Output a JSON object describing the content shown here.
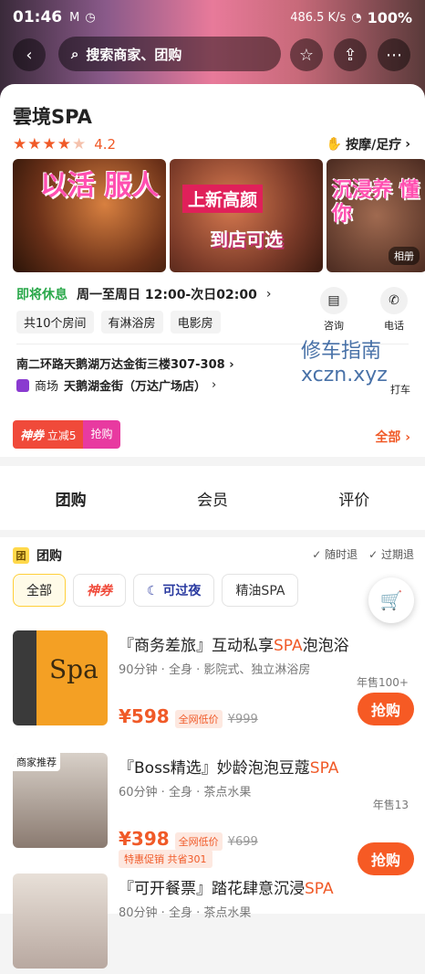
{
  "status": {
    "time": "01:46",
    "speed": "486.5 K/s",
    "battery": "100%"
  },
  "topbar": {
    "search_placeholder": "搜索商家、团购"
  },
  "shop": {
    "name": "雲境SPA",
    "rating": "4.2",
    "category": "按摩/足疗",
    "photos": [
      {
        "text": "以活 服人"
      },
      {
        "ribbon": "上新高颜",
        "text": "到店可选"
      },
      {
        "text": "沉浸养 懂你"
      }
    ],
    "album_label": "相册",
    "status": "即将休息",
    "hours": "周一至周日 12:00-次日02:00",
    "tags": [
      "共10个房间",
      "有淋浴房",
      "电影房"
    ],
    "actions": [
      {
        "label": "咨询"
      },
      {
        "label": "电话"
      }
    ],
    "address": "南二环路天鹅湖万达金街三楼307-308",
    "mall_prefix": "商场",
    "mall": "天鹅湖金街（万达广场店）",
    "taxi": "打车",
    "watermark_line1": "修车指南",
    "watermark_line2": "xczn.xyz",
    "coupon_tag": "神券",
    "coupon_text": "立减5",
    "coupon_btn": "抢购",
    "all": "全部"
  },
  "tabs": [
    "团购",
    "会员",
    "评价"
  ],
  "group": {
    "icon": "团",
    "title": "团购",
    "refund1": "随时退",
    "refund2": "过期退",
    "filters": [
      "全部",
      "神券",
      "可过夜",
      "精油SPA"
    ]
  },
  "items": [
    {
      "title_pre": "『商务差旅』互动私享",
      "title_hl": "SPA",
      "title_post": "泡泡浴",
      "desc": "90分钟 · 全身 · 影院式、独立淋浴房",
      "sold": "年售100+",
      "price": "¥598",
      "low": "全网低价",
      "orig": "¥999",
      "buy": "抢购"
    },
    {
      "badge": "商家推荐",
      "title_pre": "『Boss精选』妙龄泡泡豆蔻",
      "title_hl": "SPA",
      "title_post": "",
      "desc": "60分钟 · 全身 · 茶点水果",
      "sold": "年售13",
      "price": "¥398",
      "low": "全网低价",
      "orig": "¥699",
      "promo": "特惠促销 共省301",
      "buy": "抢购"
    },
    {
      "title_pre": "『可开餐票』踏花肆意沉浸",
      "title_hl": "SPA",
      "title_post": "",
      "desc": "80分钟 · 全身 · 茶点水果"
    }
  ]
}
